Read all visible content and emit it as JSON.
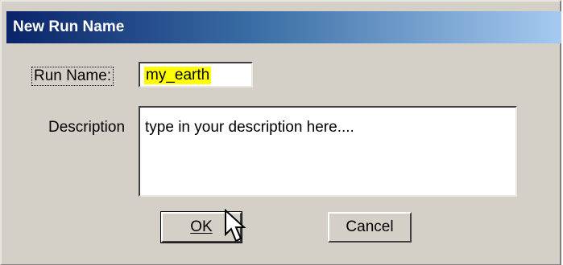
{
  "window": {
    "title": "New Run Name"
  },
  "form": {
    "run_name_label": "Run Name:",
    "run_name_value": "my_earth",
    "description_label": "Description",
    "description_value": "type in your description here...."
  },
  "buttons": {
    "ok_label": "OK",
    "cancel_label": "Cancel"
  },
  "icons": {
    "cursor": "mouse-pointer-icon"
  },
  "colors": {
    "titlebar_start": "#0a246a",
    "titlebar_end": "#a6caf0",
    "dialog_background": "#d4d0c8",
    "run_name_highlight": "#ffff00"
  }
}
